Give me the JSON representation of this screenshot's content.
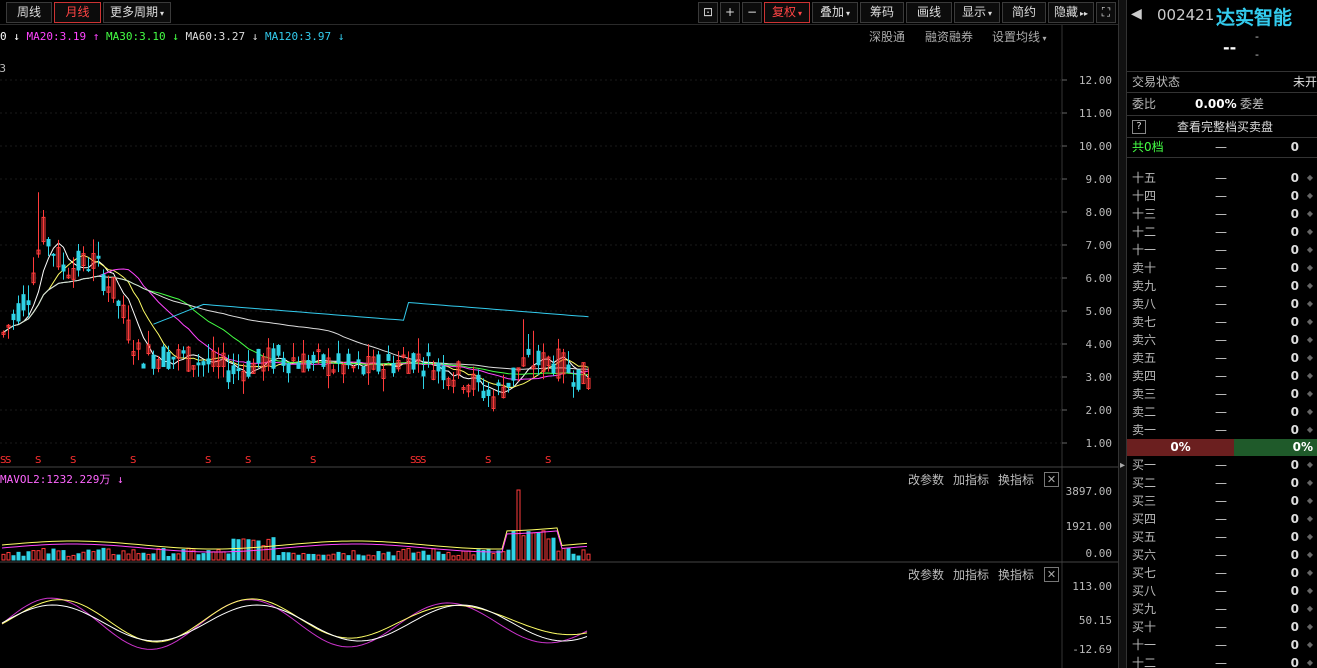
{
  "toolbar": {
    "week": "周线",
    "month": "月线",
    "more": "更多周期",
    "fuquan": "复权",
    "overlay": "叠加",
    "chips": "筹码",
    "draw": "画线",
    "display": "显示",
    "simple": "简约",
    "hide": "隐藏"
  },
  "ma": {
    "ma10": "0",
    "ma20": "MA20:3.19",
    "ma30": "MA30:3.10",
    "ma60": "MA60:3.27",
    "ma120": "MA120:3.97",
    "links": [
      "深股通",
      "融资融券",
      "设置均线"
    ]
  },
  "colors": {
    "up": "#ff3b3b",
    "down": "#2fd3e6",
    "ma10": "#ffffff",
    "ma20": "#ff44ff",
    "ma30": "#44ff44",
    "ma60": "#dddddd",
    "ma120": "#33ccee",
    "accent": "#ff4040",
    "sellbar": "#6b1f1f",
    "buybar": "#1f5a2a"
  },
  "price_axis": [
    "12.00",
    "11.00",
    "10.00",
    "9.00",
    "8.00",
    "7.00",
    "6.00",
    "5.00",
    "4.00",
    "3.00",
    "2.00",
    "1.00"
  ],
  "price_top_label": "3",
  "vol_panel": {
    "label": "MAVOL2:1232.229万",
    "buttons": [
      "改参数",
      "加指标",
      "换指标"
    ],
    "axis": [
      "3897.00",
      "1921.00",
      "0.00"
    ]
  },
  "ind_panel": {
    "buttons": [
      "改参数",
      "加指标",
      "换指标"
    ],
    "axis": [
      "113.00",
      "50.15",
      "-12.69"
    ]
  },
  "right": {
    "code": "002421",
    "name": "达实智能",
    "price": "--",
    "change_a": "-",
    "change_b": "-",
    "status_label": "交易状态",
    "status_value": "未开",
    "ratio_label": "委比",
    "ratio_value": "0.00%",
    "diff_label": "委差",
    "help": "?",
    "full_depth": "查看完整档买卖盘",
    "total_label": "共0档",
    "total_price": "—",
    "total_vol": "0",
    "sell_labels": [
      "十五",
      "十四",
      "十三",
      "十二",
      "十一",
      "卖十",
      "卖九",
      "卖八",
      "卖七",
      "卖六",
      "卖五",
      "卖四",
      "卖三",
      "卖二",
      "卖一"
    ],
    "buy_labels": [
      "买一",
      "买二",
      "买三",
      "买四",
      "买五",
      "买六",
      "买七",
      "买八",
      "买九",
      "买十",
      "十一",
      "十二"
    ],
    "dash": "—",
    "zero": "0",
    "sell_pct": "0%",
    "buy_pct": "0%"
  }
}
